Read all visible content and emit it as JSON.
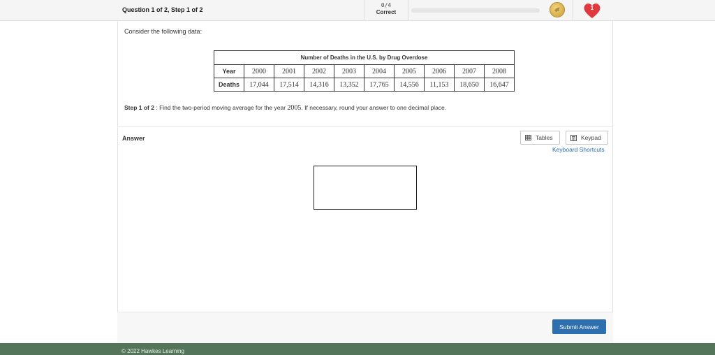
{
  "header": {
    "question_title": "Question 1 of 2, Step 1 of 2",
    "score_fraction": "0/4",
    "score_label": "Correct",
    "progress_fraction": 0,
    "lives": "1"
  },
  "prompt": {
    "consider": "Consider the following data:"
  },
  "table": {
    "caption": "Number of Deaths in the U.S. by Drug Overdose",
    "row_headers": [
      "Year",
      "Deaths"
    ],
    "years": [
      "2000",
      "2001",
      "2002",
      "2003",
      "2004",
      "2005",
      "2006",
      "2007",
      "2008"
    ],
    "deaths": [
      "17,044",
      "17,514",
      "14,316",
      "13,352",
      "17,765",
      "14,556",
      "11,153",
      "18,650",
      "16,647"
    ]
  },
  "step": {
    "label": "Step 1 of 2",
    "colon": " : ",
    "text_before": "Find the two-period moving average for the year ",
    "year": "2005",
    "text_after": ". If necessary, round your answer to one decimal place."
  },
  "answer": {
    "label": "Answer",
    "tables_button": "Tables",
    "keypad_button": "Keypad",
    "keyboard_shortcuts": "Keyboard Shortcuts",
    "submit_button": "Submit Answer"
  },
  "footer": {
    "copyright": "© 2022 Hawkes Learning"
  },
  "colors": {
    "accent": "#2e6fb0",
    "footer": "#55755a",
    "heart": "#e0393e"
  }
}
